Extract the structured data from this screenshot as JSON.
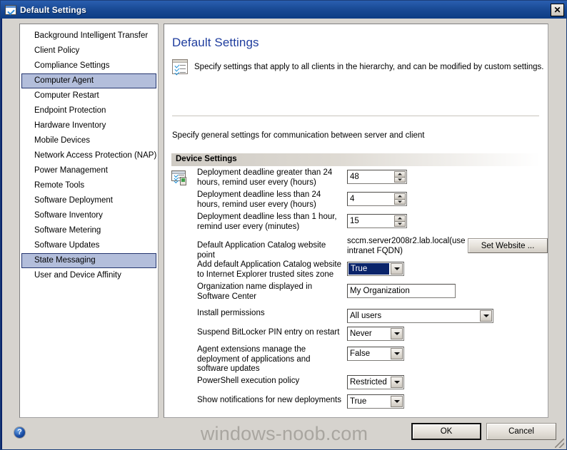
{
  "window": {
    "title": "Default Settings",
    "title_icon": "checklist-window-icon",
    "close_label": "✕"
  },
  "sidebar": {
    "items": [
      {
        "label": "Background Intelligent Transfer",
        "selected": false
      },
      {
        "label": "Client Policy",
        "selected": false
      },
      {
        "label": "Compliance Settings",
        "selected": false
      },
      {
        "label": "Computer Agent",
        "selected": true
      },
      {
        "label": "Computer Restart",
        "selected": false
      },
      {
        "label": "Endpoint Protection",
        "selected": false
      },
      {
        "label": "Hardware Inventory",
        "selected": false
      },
      {
        "label": "Mobile Devices",
        "selected": false
      },
      {
        "label": "Network Access Protection (NAP)",
        "selected": false
      },
      {
        "label": "Power Management",
        "selected": false
      },
      {
        "label": "Remote Tools",
        "selected": false
      },
      {
        "label": "Software Deployment",
        "selected": false
      },
      {
        "label": "Software Inventory",
        "selected": false
      },
      {
        "label": "Software Metering",
        "selected": false
      },
      {
        "label": "Software Updates",
        "selected": false
      },
      {
        "label": "State Messaging",
        "selected": true
      },
      {
        "label": "User and Device Affinity",
        "selected": false
      }
    ]
  },
  "content": {
    "page_title": "Default Settings",
    "description": "Specify settings that apply to all clients in the hierarchy, and can be modified by custom settings.",
    "general_text": "Specify general settings for communication between server and client",
    "section_header": "Device Settings",
    "rows": [
      {
        "label": "Deployment deadline greater than 24 hours, remind user every (hours)",
        "control": "spinner",
        "value": "48"
      },
      {
        "label": "Deployment deadline less than 24 hours, remind user every (hours)",
        "control": "spinner",
        "value": "4"
      },
      {
        "label": "Deployment deadline less than 1 hour, remind user every (minutes)",
        "control": "spinner",
        "value": "15"
      },
      {
        "label": "Default Application Catalog website point",
        "control": "static+button",
        "value": "sccm.server2008r2.lab.local(use intranet FQDN)",
        "button_label": "Set Website ..."
      },
      {
        "label": "Add default Application Catalog website to Internet Explorer trusted sites zone",
        "control": "combo",
        "value": "True",
        "focused": true
      },
      {
        "label": "Organization name displayed in Software Center",
        "control": "textbox",
        "value": "My Organization"
      },
      {
        "label": "Install permissions",
        "control": "combo-wide",
        "value": "All users"
      },
      {
        "label": "Suspend BitLocker PIN entry on restart",
        "control": "combo",
        "value": "Never"
      },
      {
        "label": "Agent extensions manage the deployment of applications and software updates",
        "control": "combo",
        "value": "False"
      },
      {
        "label": "PowerShell execution policy",
        "control": "combo",
        "value": "Restricted"
      },
      {
        "label": "Show notifications for new deployments",
        "control": "combo",
        "value": "True"
      }
    ]
  },
  "footer": {
    "help_label": "?",
    "watermark": "windows-noob.com",
    "ok_label": "OK",
    "cancel_label": "Cancel"
  }
}
